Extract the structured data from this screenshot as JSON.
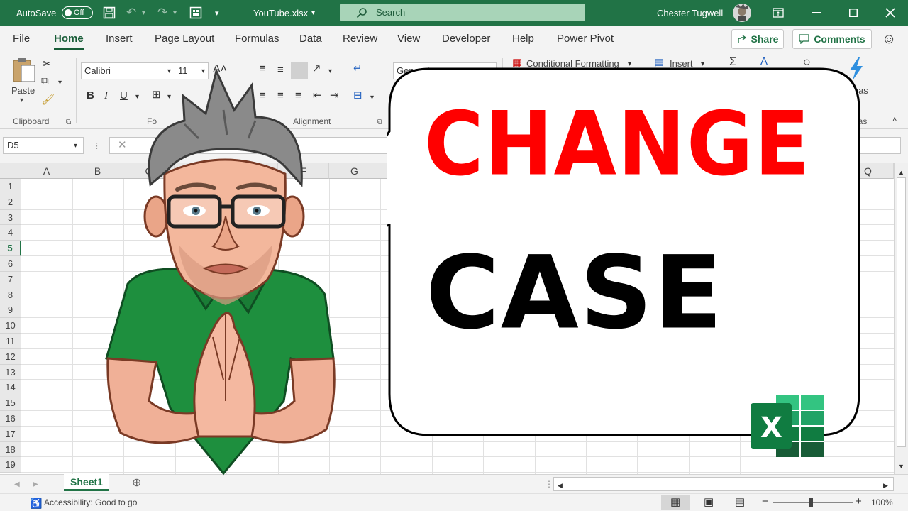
{
  "titlebar": {
    "autosave_label": "AutoSave",
    "autosave_state": "Off",
    "filename": "YouTube.xlsx",
    "search_placeholder": "Search",
    "user_name": "Chester Tugwell",
    "color": "#217346"
  },
  "menu": {
    "tabs": [
      "File",
      "Home",
      "Insert",
      "Page Layout",
      "Formulas",
      "Data",
      "Review",
      "View",
      "Developer",
      "Help",
      "Power Pivot"
    ],
    "active_tab": "Home",
    "share_label": "Share",
    "comments_label": "Comments"
  },
  "ribbon": {
    "paste_label": "Paste",
    "clipboard_label": "Clipboard",
    "font_name": "Calibri",
    "font_size": "11",
    "font_group_label": "Fo",
    "alignment_label": "Alignment",
    "number_format": "General",
    "conditional_formatting": "Conditional Formatting",
    "insert_label": "Insert",
    "ideas_label": "Ideas",
    "ideas_group_label": "eas"
  },
  "formula_bar": {
    "name_box": "D5"
  },
  "sheet": {
    "columns": [
      "A",
      "B",
      "C",
      "F",
      "G",
      "Q"
    ],
    "rows": [
      "1",
      "2",
      "3",
      "4",
      "5",
      "6",
      "7",
      "8",
      "9",
      "10",
      "11",
      "12",
      "13",
      "14",
      "15",
      "16",
      "17",
      "18",
      "19"
    ],
    "selected_row": "5",
    "tab_name": "Sheet1"
  },
  "status": {
    "accessibility": "Accessibility: Good to go",
    "zoom": "100%"
  },
  "overlay": {
    "line1": "CHANGE",
    "line2": "CASE",
    "line1_color": "#ff0000",
    "line2_color": "#000000",
    "logo_letter": "X"
  }
}
